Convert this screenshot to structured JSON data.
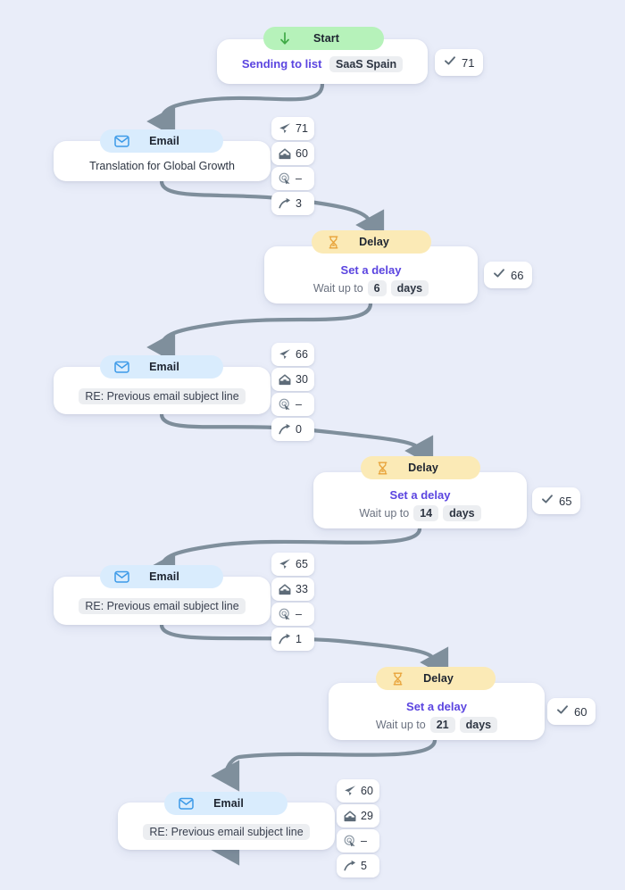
{
  "canvas": {
    "background": "#e9edf9",
    "edge_color": "#7f8f9c",
    "accent_purple": "#5b45e0"
  },
  "labels": {
    "start": "Start",
    "delay": "Delay",
    "email": "Email",
    "sending_to_list": "Sending to list",
    "set_a_delay": "Set a delay",
    "wait_up_to": "Wait up to",
    "days": "days"
  },
  "icons": {
    "start": "arrow-down-icon",
    "delay": "hourglass-icon",
    "email": "envelope-icon",
    "sent": "paper-plane-icon",
    "opened": "open-mail-icon",
    "clicked": "cursor-click-icon",
    "replied": "reply-arrow-icon",
    "check": "check-icon"
  },
  "nodes": [
    {
      "id": "start",
      "type": "start",
      "header": "Start",
      "prefix": "Sending to list",
      "list_name": "SaaS Spain",
      "check": "71"
    },
    {
      "id": "email-1",
      "type": "email",
      "header": "Email",
      "subject": "Translation for Global Growth",
      "subject_highlight": false,
      "stats": [
        {
          "icon": "paper-plane-icon",
          "label": "sent",
          "value": "71"
        },
        {
          "icon": "open-mail-icon",
          "label": "opened",
          "value": "60"
        },
        {
          "icon": "cursor-click-icon",
          "label": "clicked",
          "value": "–"
        },
        {
          "icon": "reply-arrow-icon",
          "label": "replied",
          "value": "3"
        }
      ]
    },
    {
      "id": "delay-1",
      "type": "delay",
      "header": "Delay",
      "title": "Set a delay",
      "wait_prefix": "Wait up to",
      "amount": "6",
      "unit": "days",
      "check": "66"
    },
    {
      "id": "email-2",
      "type": "email",
      "header": "Email",
      "subject": "RE: Previous email subject line",
      "subject_highlight": true,
      "stats": [
        {
          "icon": "paper-plane-icon",
          "label": "sent",
          "value": "66"
        },
        {
          "icon": "open-mail-icon",
          "label": "opened",
          "value": "30"
        },
        {
          "icon": "cursor-click-icon",
          "label": "clicked",
          "value": "–"
        },
        {
          "icon": "reply-arrow-icon",
          "label": "replied",
          "value": "0"
        }
      ]
    },
    {
      "id": "delay-2",
      "type": "delay",
      "header": "Delay",
      "title": "Set a delay",
      "wait_prefix": "Wait up to",
      "amount": "14",
      "unit": "days",
      "check": "65"
    },
    {
      "id": "email-3",
      "type": "email",
      "header": "Email",
      "subject": "RE: Previous email subject line",
      "subject_highlight": true,
      "stats": [
        {
          "icon": "paper-plane-icon",
          "label": "sent",
          "value": "65"
        },
        {
          "icon": "open-mail-icon",
          "label": "opened",
          "value": "33"
        },
        {
          "icon": "cursor-click-icon",
          "label": "clicked",
          "value": "–"
        },
        {
          "icon": "reply-arrow-icon",
          "label": "replied",
          "value": "1"
        }
      ]
    },
    {
      "id": "delay-3",
      "type": "delay",
      "header": "Delay",
      "title": "Set a delay",
      "wait_prefix": "Wait up to",
      "amount": "21",
      "unit": "days",
      "check": "60"
    },
    {
      "id": "email-4",
      "type": "email",
      "header": "Email",
      "subject": "RE: Previous email subject line",
      "subject_highlight": true,
      "stats": [
        {
          "icon": "paper-plane-icon",
          "label": "sent",
          "value": "60"
        },
        {
          "icon": "open-mail-icon",
          "label": "opened",
          "value": "29"
        },
        {
          "icon": "cursor-click-icon",
          "label": "clicked",
          "value": "–"
        },
        {
          "icon": "reply-arrow-icon",
          "label": "replied",
          "value": "5"
        }
      ]
    }
  ]
}
